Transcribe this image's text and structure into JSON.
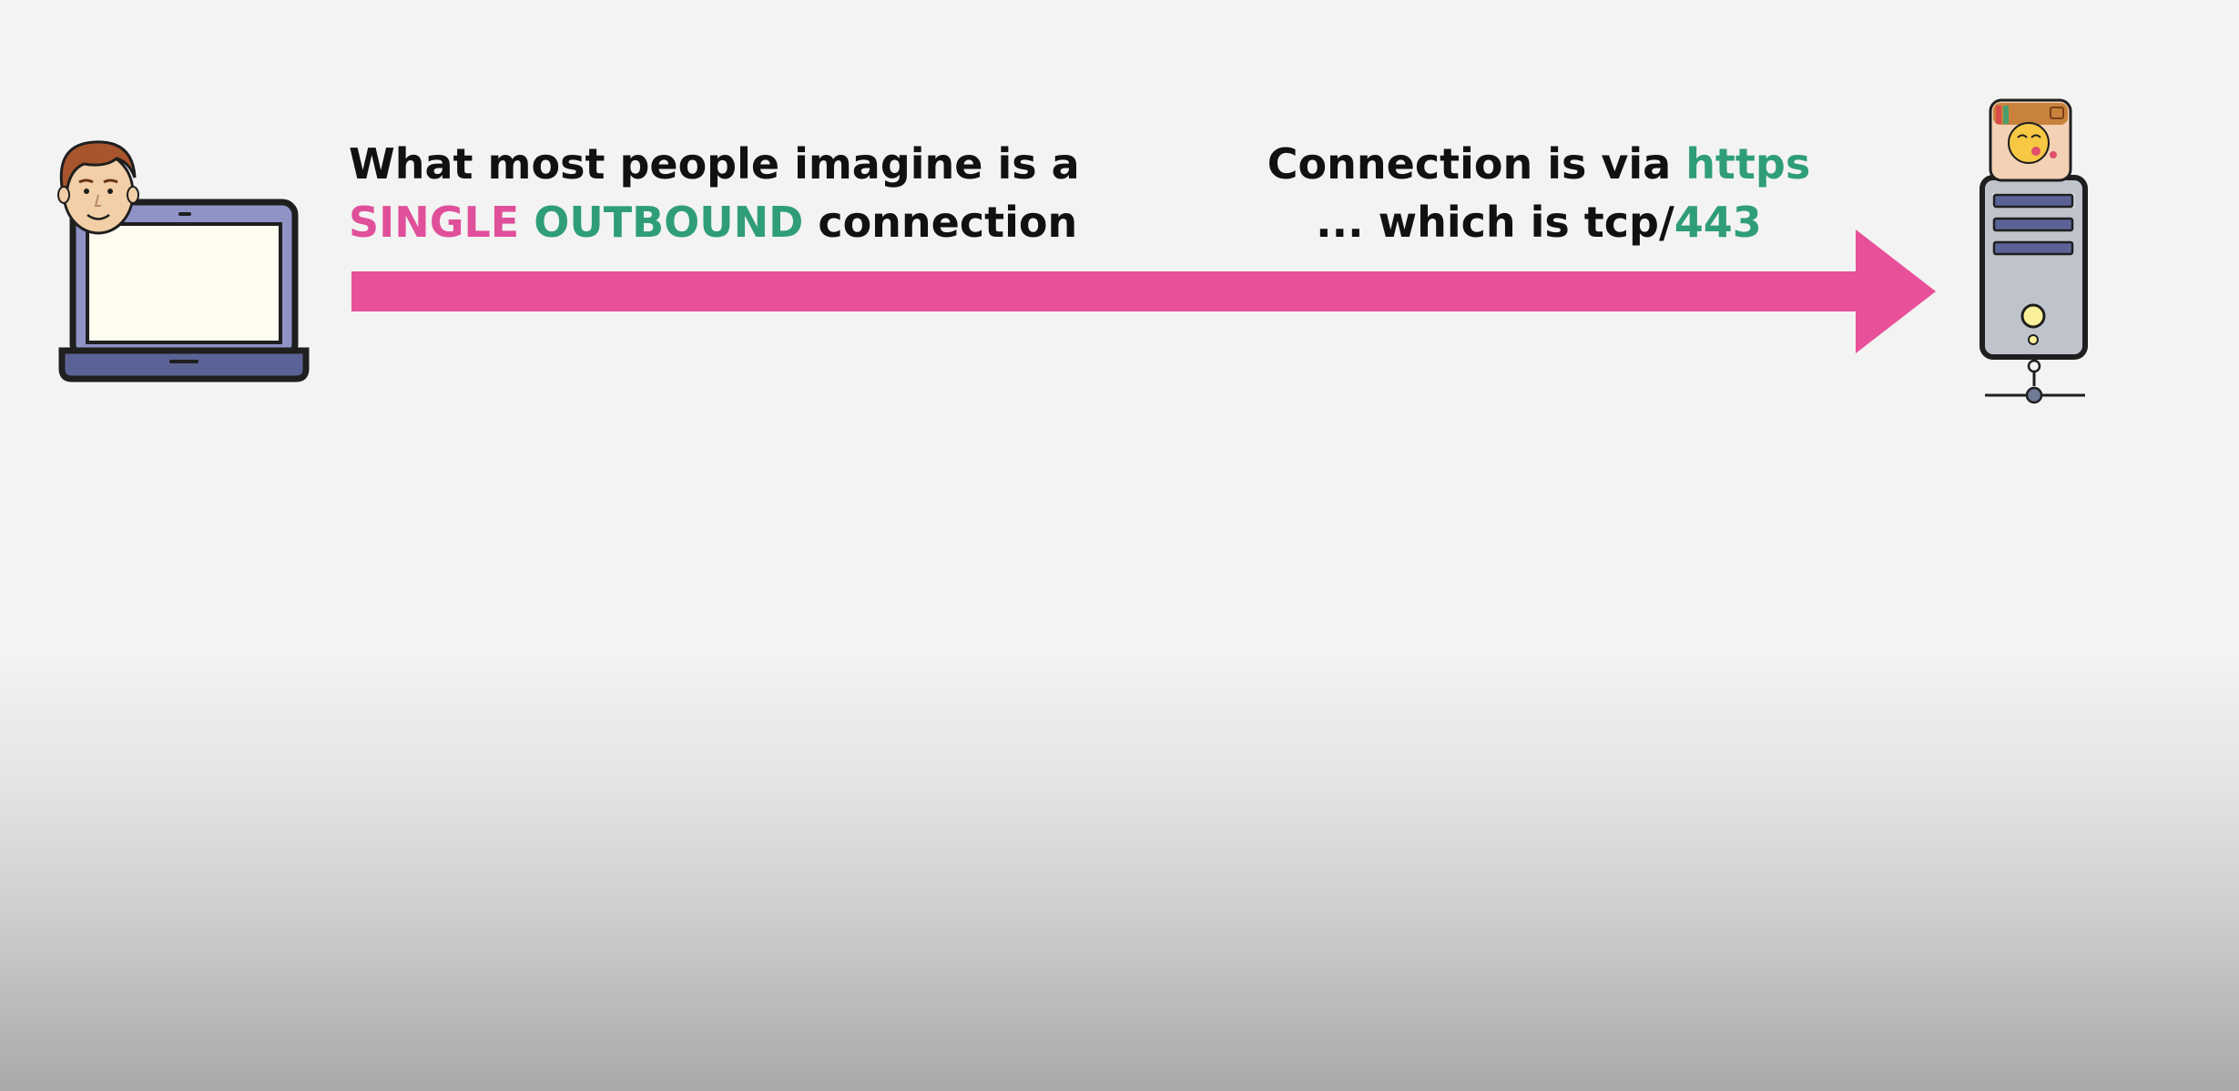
{
  "captions": {
    "left": {
      "line1": "What most people imagine is a",
      "word_single": "SINGLE",
      "word_outbound": "OUTBOUND",
      "word_connection": "connection"
    },
    "right": {
      "line1_prefix": "Connection is via",
      "word_https": "https",
      "line2_prefix": "... which is tcp/",
      "word_port": "443"
    }
  },
  "colors": {
    "arrow": "#e8509a",
    "highlight_pink": "#e0509a",
    "highlight_green": "#2f9e78",
    "laptop_body": "#8f93c6",
    "laptop_base": "#5b6396",
    "screen": "#fffdf0",
    "server_body": "#bfc4cc",
    "server_slot": "#5b6396",
    "outline": "#1f1f1f"
  },
  "icons": {
    "client": "user-laptop-icon",
    "server": "server-icon",
    "server_badge": "app-avatar-icon",
    "arrow": "arrow-right-icon"
  }
}
